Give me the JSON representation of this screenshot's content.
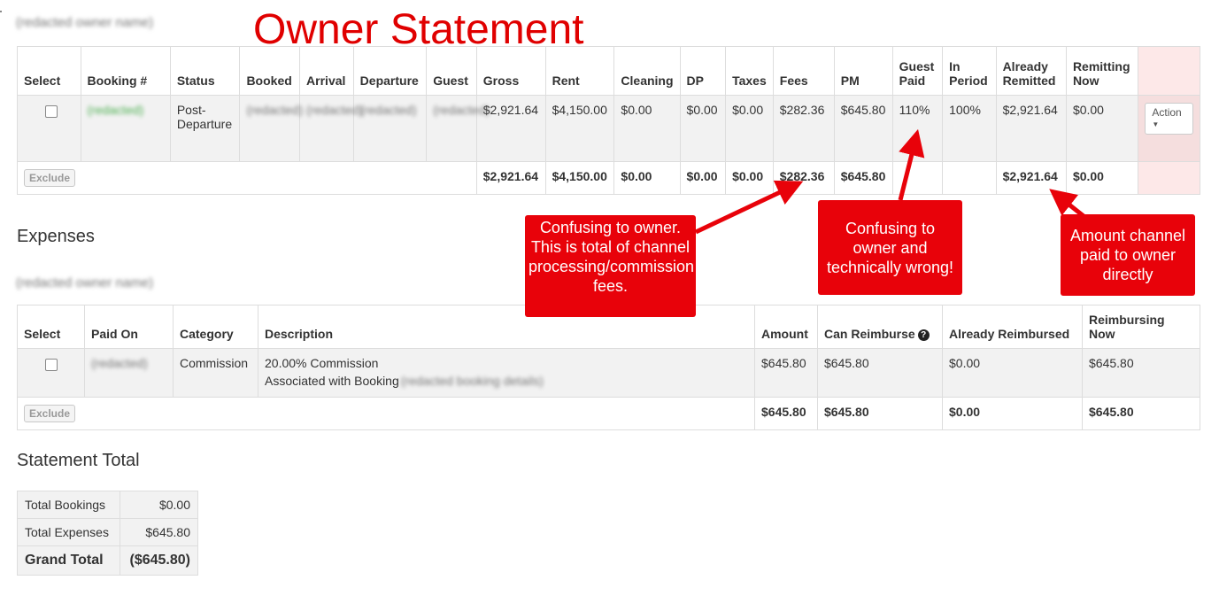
{
  "page_title": "Owner Statement",
  "owner_name": "(redacted owner name)",
  "bookings": {
    "headers": [
      "Select",
      "Booking #",
      "Status",
      "Booked",
      "Arrival",
      "Departure",
      "Guest",
      "Gross",
      "Rent",
      "Cleaning",
      "DP",
      "Taxes",
      "Fees",
      "PM",
      "Guest Paid",
      "In Period",
      "Already Remitted",
      "Remitting Now"
    ],
    "row": {
      "booking_number": "(redacted)",
      "status": "Post-Departure",
      "booked": "(redacted)",
      "arrival": "(redacted)",
      "departure": "(redacted)",
      "guest": "(redacted)",
      "gross": "$2,921.64",
      "rent": "$4,150.00",
      "cleaning": "$0.00",
      "dp": "$0.00",
      "taxes": "$0.00",
      "fees": "$282.36",
      "pm": "$645.80",
      "guest_paid": "110%",
      "in_period": "100%",
      "already_remitted": "$2,921.64",
      "remitting_now": "$0.00",
      "action_label": "Action"
    },
    "totals": {
      "exclude_label": "Exclude",
      "gross": "$2,921.64",
      "rent": "$4,150.00",
      "cleaning": "$0.00",
      "dp": "$0.00",
      "taxes": "$0.00",
      "fees": "$282.36",
      "pm": "$645.80",
      "already_remitted": "$2,921.64",
      "remitting_now": "$0.00"
    }
  },
  "expenses": {
    "heading": "Expenses",
    "subheading": "(redacted owner name)",
    "headers": [
      "Select",
      "Paid On",
      "Category",
      "Description",
      "Amount",
      "Can Reimburse",
      "Already Reimbursed",
      "Reimbursing Now"
    ],
    "help_icon": "question-circle-icon",
    "row": {
      "paid_on": "(redacted)",
      "category": "Commission",
      "description_line1": "20.00% Commission",
      "description_line2": "Associated with Booking",
      "description_redacted": "(redacted booking details)",
      "amount": "$645.80",
      "can_reimburse": "$645.80",
      "already_reimbursed": "$0.00",
      "reimbursing_now": "$645.80"
    },
    "totals": {
      "exclude_label": "Exclude",
      "amount": "$645.80",
      "can_reimburse": "$645.80",
      "already_reimbursed": "$0.00",
      "reimbursing_now": "$645.80"
    }
  },
  "statement_total": {
    "heading": "Statement Total",
    "rows": [
      {
        "label": "Total Bookings",
        "value": "$0.00"
      },
      {
        "label": "Total Expenses",
        "value": "$645.80"
      },
      {
        "label": "Grand Total",
        "value": "($645.80)"
      }
    ]
  },
  "annotations": {
    "color": "#e8020a",
    "fees_note": "Confusing to owner. This is total of channel processing/commission fees.",
    "guest_paid_note": "Confusing to owner and technically wrong!",
    "remitted_note": "Amount channel paid to owner directly"
  }
}
